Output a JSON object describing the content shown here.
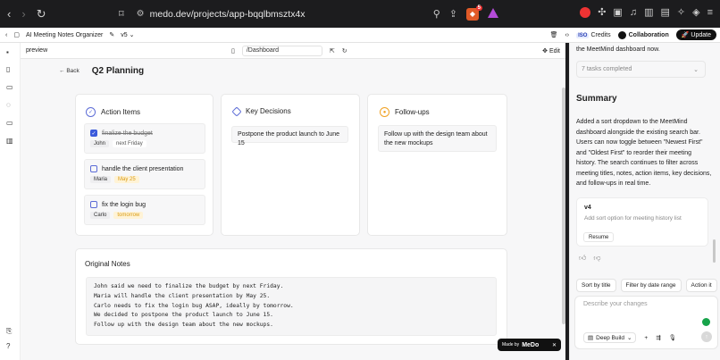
{
  "browser": {
    "url": "medo.dev/projects/app-bqqlbmsztx4x",
    "brave_badge": "5"
  },
  "appbar": {
    "project_name": "AI Meeting Notes Organizer",
    "version": "v5",
    "iso_badge": "ISO",
    "credits_label": "Credits",
    "collaboration_label": "Collaboration",
    "update_label": "Update"
  },
  "preview": {
    "label": "preview",
    "route": "/Dashboard",
    "edit_label": "Edit"
  },
  "page": {
    "back_label": "Back",
    "title": "Q2 Planning"
  },
  "action_items": {
    "title": "Action Items",
    "items": [
      {
        "text": "finalize the budget",
        "done": true,
        "assignee": "John",
        "due": "next Friday",
        "due_style": "light"
      },
      {
        "text": "handle the client presentation",
        "done": false,
        "assignee": "Maria",
        "due": "May 25",
        "due_style": "orange"
      },
      {
        "text": "fix the login bug",
        "done": false,
        "assignee": "Carlo",
        "due": "tomorrow",
        "due_style": "orange"
      }
    ]
  },
  "key_decisions": {
    "title": "Key Decisions",
    "items": [
      "Postpone the product launch to June 15"
    ]
  },
  "follow_ups": {
    "title": "Follow-ups",
    "items": [
      "Follow up with the design team about the new mockups"
    ]
  },
  "original_notes": {
    "title": "Original Notes",
    "text": "John said we need to finalize the budget by next Friday.\nMaria will handle the client presentation by May 25.\nCarlo needs to fix the login bug ASAP, ideally by tomorrow.\nWe decided to postpone the product launch to June 15.\nFollow up with the design team about the new mockups."
  },
  "badge": {
    "made_by": "Made by",
    "brand": "MeDo"
  },
  "chat": {
    "intro_tail": "the MeetMind dashboard now.",
    "tasks_completed": "7 tasks completed",
    "summary_title": "Summary",
    "summary_text": "Added a sort dropdown to the MeetMind dashboard alongside the existing search bar. Users can now toggle between \"Newest First\" and \"Oldest First\" to reorder their meeting history. The search continues to filter across meeting titles, notes, action items, key decisions, and follow-ups in real time.",
    "version_label": "v4",
    "version_desc": "Add sort option for meeting history list",
    "resume_label": "Resume",
    "suggestions": [
      "Sort by title",
      "Filter by date range",
      "Action it"
    ],
    "composer_placeholder": "Describe your changes",
    "deep_build_label": "Deep Build"
  }
}
